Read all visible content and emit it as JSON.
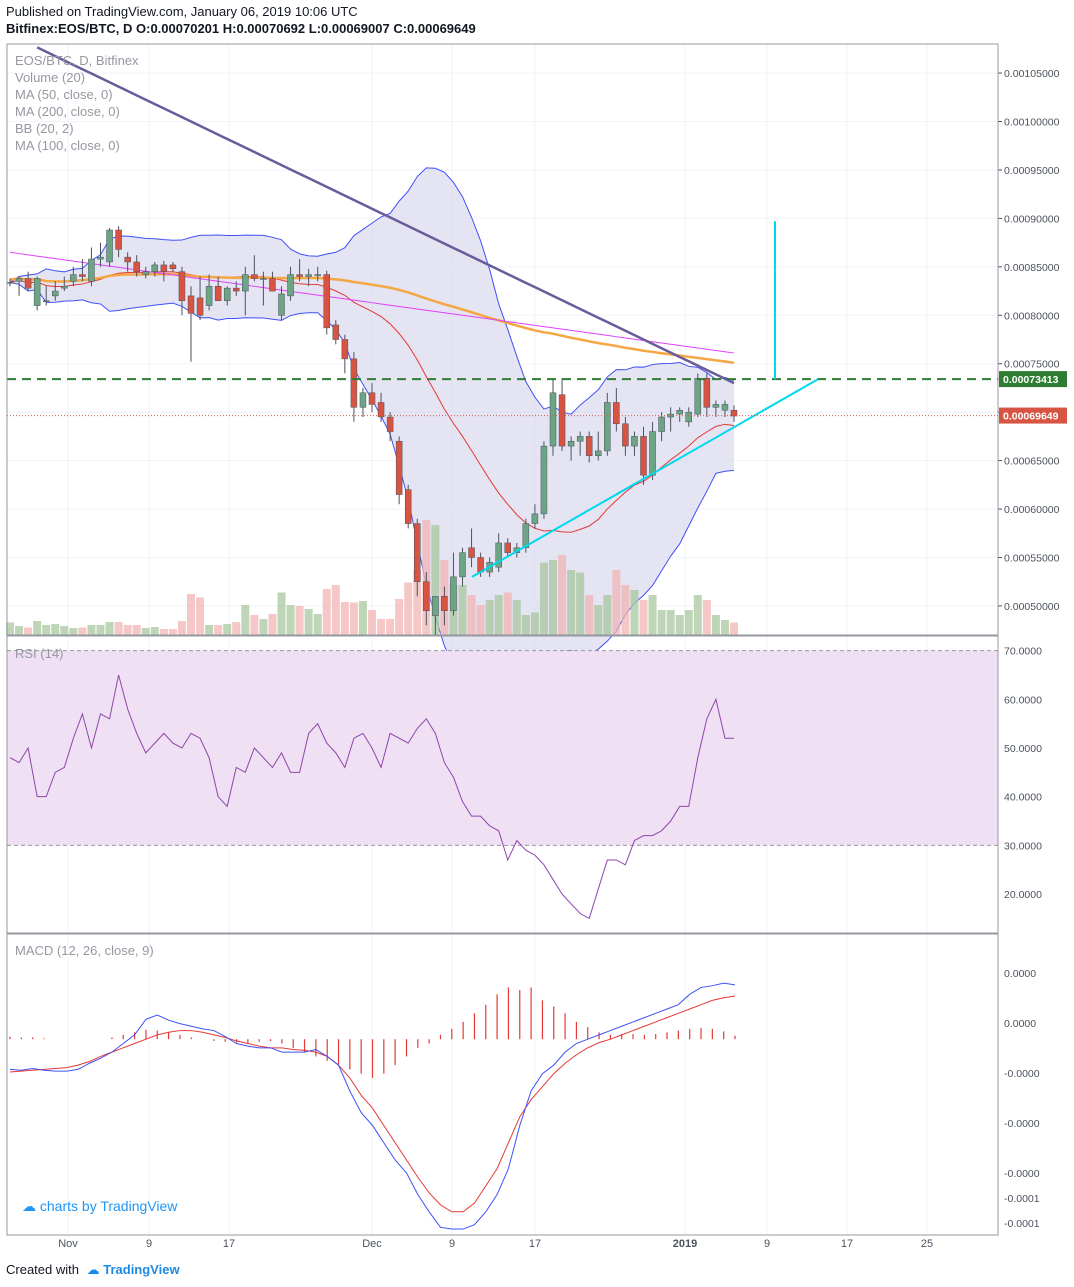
{
  "header": {
    "published": "Published on TradingView.com, January 06, 2019 10:06 UTC",
    "ohlc": "Bitfinex:EOS/BTC, D  O:0.00070201 H:0.00070692 L:0.00069007 C:0.00069649"
  },
  "legend": {
    "main": [
      "EOS/BTC, D, Bitfinex",
      "Volume (20)",
      "MA (50, close, 0)",
      "MA (200, close, 0)",
      "BB (20, 2)",
      "MA (100, close, 0)"
    ],
    "rsi": "RSI (14)",
    "macd": "MACD (12, 26, close, 9)"
  },
  "watermark": "charts by TradingView",
  "footer": {
    "created_with": "Created with",
    "brand": "TradingView"
  },
  "colors": {
    "up": "#6ba583",
    "down": "#d75442",
    "vol_up": "#a9c79f",
    "vol_down": "#f2b4b4",
    "bb_line": "#3f51f5",
    "bb_fill": "#d9d9ee",
    "ma50": "#f4a742",
    "ma100": "#e040fb",
    "ma200": "#6a5b9b",
    "sma20": "#e53935",
    "trend": "#00d8f0",
    "dashed": "#2e7d32",
    "rsi_line": "#8e44ad",
    "rsi_band": "#efe1f3",
    "macd_line": "#3f51f5",
    "signal_line": "#e53935",
    "hist": "#e53935"
  },
  "chart_data": {
    "type": "candlestick",
    "symbol": "EOS/BTC",
    "exchange": "Bitfinex",
    "interval": "D",
    "x_axis": {
      "ticks": [
        "Nov",
        "9",
        "17",
        "Dec",
        "9",
        "17",
        "2019",
        "9",
        "17",
        "25"
      ]
    },
    "price_axis": {
      "ticks": [
        "0.00105000",
        "0.00100000",
        "0.00095000",
        "0.00090000",
        "0.00085000",
        "0.00080000",
        "0.00075000",
        "0.00070000",
        "0.00065000",
        "0.00060000",
        "0.00055000",
        "0.00050000"
      ],
      "range": [
        0.00047,
        0.00108
      ],
      "level_label": "0.00073413",
      "last_label": "0.00069649",
      "level": 0.00073413,
      "last": 0.00069649
    },
    "candles": [
      {
        "o": 0.000834,
        "h": 0.000838,
        "l": 0.00083,
        "c": 0.000834
      },
      {
        "o": 0.000835,
        "h": 0.00084,
        "l": 0.00082,
        "c": 0.000838
      },
      {
        "o": 0.000838,
        "h": 0.000845,
        "l": 0.000825,
        "c": 0.000828
      },
      {
        "o": 0.00081,
        "h": 0.00084,
        "l": 0.000805,
        "c": 0.000838
      },
      {
        "o": 0.000815,
        "h": 0.00083,
        "l": 0.00081,
        "c": 0.000815
      },
      {
        "o": 0.00082,
        "h": 0.000835,
        "l": 0.000815,
        "c": 0.000825
      },
      {
        "o": 0.000828,
        "h": 0.00084,
        "l": 0.000825,
        "c": 0.00083
      },
      {
        "o": 0.000835,
        "h": 0.00085,
        "l": 0.00083,
        "c": 0.000842
      },
      {
        "o": 0.000842,
        "h": 0.000858,
        "l": 0.000835,
        "c": 0.00084
      },
      {
        "o": 0.000835,
        "h": 0.00087,
        "l": 0.00083,
        "c": 0.000858
      },
      {
        "o": 0.000858,
        "h": 0.000875,
        "l": 0.00085,
        "c": 0.00086
      },
      {
        "o": 0.000855,
        "h": 0.00089,
        "l": 0.00085,
        "c": 0.000888
      },
      {
        "o": 0.000888,
        "h": 0.000892,
        "l": 0.00086,
        "c": 0.000868
      },
      {
        "o": 0.00086,
        "h": 0.000865,
        "l": 0.000845,
        "c": 0.000855
      },
      {
        "o": 0.000855,
        "h": 0.000862,
        "l": 0.00084,
        "c": 0.000845
      },
      {
        "o": 0.000842,
        "h": 0.00085,
        "l": 0.000838,
        "c": 0.000845
      },
      {
        "o": 0.000845,
        "h": 0.000855,
        "l": 0.00084,
        "c": 0.000852
      },
      {
        "o": 0.000852,
        "h": 0.000856,
        "l": 0.000835,
        "c": 0.000845
      },
      {
        "o": 0.000852,
        "h": 0.000855,
        "l": 0.000845,
        "c": 0.000848
      },
      {
        "o": 0.000845,
        "h": 0.00085,
        "l": 0.0008,
        "c": 0.000815
      },
      {
        "o": 0.00082,
        "h": 0.00083,
        "l": 0.000752,
        "c": 0.000802
      },
      {
        "o": 0.000818,
        "h": 0.00084,
        "l": 0.000795,
        "c": 0.0008
      },
      {
        "o": 0.00081,
        "h": 0.000842,
        "l": 0.000805,
        "c": 0.00083
      },
      {
        "o": 0.00083,
        "h": 0.00084,
        "l": 0.000815,
        "c": 0.000815
      },
      {
        "o": 0.000815,
        "h": 0.00083,
        "l": 0.00081,
        "c": 0.000828
      },
      {
        "o": 0.000828,
        "h": 0.000835,
        "l": 0.00082,
        "c": 0.000825
      },
      {
        "o": 0.000825,
        "h": 0.00085,
        "l": 0.0008,
        "c": 0.000842
      },
      {
        "o": 0.000842,
        "h": 0.000862,
        "l": 0.000835,
        "c": 0.000838
      },
      {
        "o": 0.000838,
        "h": 0.000845,
        "l": 0.00081,
        "c": 0.000838
      },
      {
        "o": 0.000838,
        "h": 0.000845,
        "l": 0.000825,
        "c": 0.000825
      },
      {
        "o": 0.0008,
        "h": 0.00083,
        "l": 0.000795,
        "c": 0.000822
      },
      {
        "o": 0.00082,
        "h": 0.00085,
        "l": 0.000815,
        "c": 0.000842
      },
      {
        "o": 0.000842,
        "h": 0.000858,
        "l": 0.000835,
        "c": 0.00084
      },
      {
        "o": 0.00084,
        "h": 0.000848,
        "l": 0.00083,
        "c": 0.000842
      },
      {
        "o": 0.000842,
        "h": 0.00085,
        "l": 0.000835,
        "c": 0.000842
      },
      {
        "o": 0.000842,
        "h": 0.000846,
        "l": 0.00078,
        "c": 0.000787
      },
      {
        "o": 0.00079,
        "h": 0.000795,
        "l": 0.00077,
        "c": 0.000775
      },
      {
        "o": 0.000775,
        "h": 0.00078,
        "l": 0.00074,
        "c": 0.000755
      },
      {
        "o": 0.000755,
        "h": 0.000762,
        "l": 0.00069,
        "c": 0.000705
      },
      {
        "o": 0.000705,
        "h": 0.000725,
        "l": 0.000695,
        "c": 0.00072
      },
      {
        "o": 0.00072,
        "h": 0.00073,
        "l": 0.0007,
        "c": 0.000708
      },
      {
        "o": 0.00071,
        "h": 0.00072,
        "l": 0.00069,
        "c": 0.000695
      },
      {
        "o": 0.000695,
        "h": 0.0007,
        "l": 0.00067,
        "c": 0.00068
      },
      {
        "o": 0.00067,
        "h": 0.000675,
        "l": 0.000605,
        "c": 0.000615
      },
      {
        "o": 0.00062,
        "h": 0.000625,
        "l": 0.00058,
        "c": 0.000585
      },
      {
        "o": 0.000585,
        "h": 0.00059,
        "l": 0.00051,
        "c": 0.000525
      },
      {
        "o": 0.000525,
        "h": 0.000535,
        "l": 0.00048,
        "c": 0.000495
      },
      {
        "o": 0.00049,
        "h": 0.000505,
        "l": 0.00047,
        "c": 0.00051
      },
      {
        "o": 0.00051,
        "h": 0.00052,
        "l": 0.00048,
        "c": 0.000495
      },
      {
        "o": 0.000495,
        "h": 0.000555,
        "l": 0.00049,
        "c": 0.00053
      },
      {
        "o": 0.00053,
        "h": 0.00056,
        "l": 0.00052,
        "c": 0.000555
      },
      {
        "o": 0.00056,
        "h": 0.00058,
        "l": 0.00054,
        "c": 0.00055
      },
      {
        "o": 0.00055,
        "h": 0.000555,
        "l": 0.00053,
        "c": 0.000535
      },
      {
        "o": 0.000535,
        "h": 0.00055,
        "l": 0.00053,
        "c": 0.000545
      },
      {
        "o": 0.00054,
        "h": 0.000575,
        "l": 0.000535,
        "c": 0.000565
      },
      {
        "o": 0.000565,
        "h": 0.00057,
        "l": 0.00055,
        "c": 0.000555
      },
      {
        "o": 0.000555,
        "h": 0.000565,
        "l": 0.00055,
        "c": 0.00056
      },
      {
        "o": 0.00056,
        "h": 0.00059,
        "l": 0.000555,
        "c": 0.000585
      },
      {
        "o": 0.000585,
        "h": 0.000605,
        "l": 0.00058,
        "c": 0.000595
      },
      {
        "o": 0.000595,
        "h": 0.00067,
        "l": 0.00059,
        "c": 0.000665
      },
      {
        "o": 0.000665,
        "h": 0.000735,
        "l": 0.000655,
        "c": 0.00072
      },
      {
        "o": 0.000718,
        "h": 0.000735,
        "l": 0.00066,
        "c": 0.000665
      },
      {
        "o": 0.000665,
        "h": 0.000675,
        "l": 0.00065,
        "c": 0.00067
      },
      {
        "o": 0.00067,
        "h": 0.00068,
        "l": 0.000655,
        "c": 0.000675
      },
      {
        "o": 0.000675,
        "h": 0.00068,
        "l": 0.000648,
        "c": 0.000655
      },
      {
        "o": 0.000655,
        "h": 0.00068,
        "l": 0.00065,
        "c": 0.00066
      },
      {
        "o": 0.00066,
        "h": 0.00072,
        "l": 0.000655,
        "c": 0.00071
      },
      {
        "o": 0.00071,
        "h": 0.000725,
        "l": 0.00068,
        "c": 0.000688
      },
      {
        "o": 0.000688,
        "h": 0.000695,
        "l": 0.000655,
        "c": 0.000665
      },
      {
        "o": 0.000665,
        "h": 0.00068,
        "l": 0.000655,
        "c": 0.000675
      },
      {
        "o": 0.000675,
        "h": 0.000685,
        "l": 0.000625,
        "c": 0.000635
      },
      {
        "o": 0.000635,
        "h": 0.00069,
        "l": 0.00063,
        "c": 0.00068
      },
      {
        "o": 0.00068,
        "h": 0.0007,
        "l": 0.00067,
        "c": 0.000695
      },
      {
        "o": 0.000695,
        "h": 0.000705,
        "l": 0.00068,
        "c": 0.000698
      },
      {
        "o": 0.000698,
        "h": 0.000705,
        "l": 0.00069,
        "c": 0.000702
      },
      {
        "o": 0.00069,
        "h": 0.000705,
        "l": 0.000685,
        "c": 0.0007
      },
      {
        "o": 0.000698,
        "h": 0.00074,
        "l": 0.000695,
        "c": 0.000735
      },
      {
        "o": 0.000735,
        "h": 0.00074,
        "l": 0.000695,
        "c": 0.000705
      },
      {
        "o": 0.000705,
        "h": 0.000712,
        "l": 0.000695,
        "c": 0.000708
      },
      {
        "o": 0.000702,
        "h": 0.000712,
        "l": 0.000695,
        "c": 0.000708
      },
      {
        "o": 0.000702,
        "h": 0.000707,
        "l": 0.00069,
        "c": 0.000696
      }
    ],
    "volume": [
      0.25,
      0.18,
      0.15,
      0.28,
      0.2,
      0.22,
      0.18,
      0.14,
      0.15,
      0.2,
      0.2,
      0.26,
      0.26,
      0.2,
      0.2,
      0.14,
      0.16,
      0.12,
      0.12,
      0.28,
      0.82,
      0.75,
      0.2,
      0.2,
      0.22,
      0.26,
      0.6,
      0.4,
      0.32,
      0.42,
      0.85,
      0.6,
      0.58,
      0.52,
      0.42,
      0.92,
      1.0,
      0.66,
      0.65,
      0.68,
      0.5,
      0.32,
      0.32,
      0.72,
      1.05,
      1.3,
      2.3,
      2.2,
      1.5,
      1.0,
      1.0,
      0.8,
      0.6,
      0.7,
      0.8,
      0.85,
      0.7,
      0.4,
      0.45,
      1.45,
      1.5,
      1.6,
      1.3,
      1.25,
      0.8,
      0.6,
      0.8,
      1.3,
      1.0,
      0.9,
      0.7,
      0.8,
      0.5,
      0.5,
      0.4,
      0.5,
      0.8,
      0.7,
      0.4,
      0.3,
      0.25
    ],
    "volume_labels": [],
    "rsi": {
      "ticks": [
        "70.0000",
        "60.0000",
        "50.0000",
        "40.0000",
        "30.0000",
        "20.0000"
      ],
      "range": [
        12,
        73
      ],
      "band": [
        30,
        70
      ],
      "values": [
        48,
        47,
        50,
        40,
        40,
        45,
        46,
        52,
        57,
        50,
        57,
        56,
        65,
        58,
        53,
        49,
        51,
        53,
        51,
        50,
        53,
        52,
        48,
        40,
        38,
        46,
        45,
        50,
        48,
        46,
        49,
        45,
        45,
        53,
        55,
        51,
        49,
        46,
        52,
        53,
        50,
        46,
        53,
        52,
        51,
        54,
        56,
        53,
        47,
        44,
        39,
        36,
        36,
        34,
        33,
        27,
        31,
        29,
        28,
        26,
        23,
        20,
        18,
        16,
        15,
        21,
        27,
        27,
        26,
        31,
        32,
        32,
        33,
        35,
        38,
        38,
        48,
        56,
        60,
        52,
        52
      ]
    },
    "macd": {
      "ticks": [
        "0.0000",
        "0.0000",
        "-0.0000",
        "-0.0000",
        "-0.0000",
        "-0.0001",
        "-0.0001"
      ],
      "range": [
        -2.13e-05,
        1.08e-05
      ],
      "macd_values": [
        -3.5e-06,
        -3.6e-06,
        -3.4e-06,
        -3.6e-06,
        -3.7e-06,
        -3.7e-06,
        -3.5e-06,
        -2.8e-06,
        -2.2e-06,
        -1.5e-06,
        -5e-07,
        5e-07,
        2.3e-06,
        2.8e-06,
        2.2e-06,
        1.8e-06,
        1.5e-06,
        1.2e-06,
        1e-06,
        3e-07,
        -5e-07,
        -8e-07,
        -1e-06,
        -1e-06,
        -1.5e-06,
        -1.5e-06,
        -1.5e-06,
        -1.2e-06,
        -2e-06,
        -3e-06,
        -6e-06,
        -8.5e-06,
        -1e-05,
        -1.2e-05,
        -1.4e-05,
        -1.55e-05,
        -1.8e-05,
        -2e-05,
        -2.18e-05,
        -2.2e-05,
        -2.2e-05,
        -2.15e-05,
        -2e-05,
        -1.8e-05,
        -1.5e-05,
        -1e-05,
        -6e-06,
        -4e-06,
        -3e-06,
        -1.5e-06,
        -5e-07,
        0.0,
        5e-07,
        1e-06,
        1.5e-06,
        2e-06,
        2.5e-06,
        3e-06,
        3.5e-06,
        4e-06,
        5.2e-06,
        6e-06,
        6.2e-06,
        6.5e-06,
        6.3e-06
      ],
      "signal_values": [
        -3.8e-06,
        -3.7e-06,
        -3.6e-06,
        -3.5e-06,
        -3.4e-06,
        -3.3e-06,
        -3e-06,
        -2.6e-06,
        -2e-06,
        -1.5e-06,
        -1e-06,
        -5e-07,
        0.0,
        5e-07,
        8e-07,
        1e-06,
        1e-06,
        8e-07,
        5e-07,
        2e-07,
        -2e-07,
        -5e-07,
        -8e-07,
        -1e-06,
        -1e-06,
        -1.2e-06,
        -1.3e-06,
        -1.5e-06,
        -2e-06,
        -3e-06,
        -4.5e-06,
        -6.5e-06,
        -8e-06,
        -1e-05,
        -1.2e-05,
        -1.4e-05,
        -1.6e-05,
        -1.78e-05,
        -1.92e-05,
        -2e-05,
        -2e-05,
        -1.9e-05,
        -1.7e-05,
        -1.5e-05,
        -1.2e-05,
        -9e-06,
        -7e-06,
        -5.5e-06,
        -4e-06,
        -2.8e-06,
        -1.8e-06,
        -1e-06,
        -4e-07,
        0.0,
        5e-07,
        1e-06,
        1.5e-06,
        2e-06,
        2.5e-06,
        3e-06,
        3.5e-06,
        4e-06,
        4.5e-06,
        4.8e-06,
        5e-06
      ],
      "hist": [
        3e-07,
        2e-07,
        2e-07,
        1e-07,
        0.0,
        0.0,
        0.0,
        0.0,
        0.0,
        2e-07,
        5e-07,
        8e-07,
        1.1e-06,
        1e-06,
        8e-07,
        5e-07,
        2e-07,
        0.0,
        -2e-07,
        -3e-07,
        -4e-07,
        -5e-07,
        -3e-07,
        -2e-07,
        -5e-07,
        -1e-06,
        -1.5e-06,
        -2e-06,
        -2.5e-06,
        -3e-06,
        -3.5e-06,
        -4e-06,
        -4.5e-06,
        -4e-06,
        -3e-06,
        -2e-06,
        -1e-06,
        -5e-07,
        5e-07,
        1.2e-06,
        2e-06,
        3e-06,
        4e-06,
        5.2e-06,
        6e-06,
        5.7e-06,
        6e-06,
        4.5e-06,
        3.8e-06,
        3e-06,
        2e-06,
        1.4e-06,
        8e-07,
        5e-07,
        6e-07,
        6e-07,
        5e-07,
        6e-07,
        8e-07,
        1e-06,
        1.2e-06,
        1.3e-06,
        1.2e-06,
        9e-07,
        4e-07
      ]
    }
  }
}
